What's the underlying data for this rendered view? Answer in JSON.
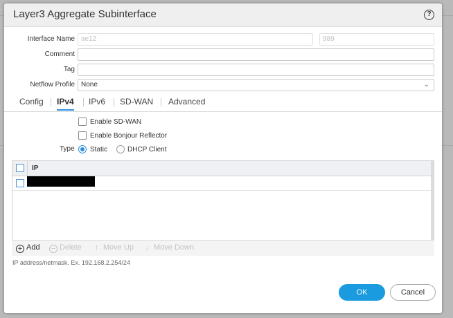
{
  "dialog": {
    "title": "Layer3 Aggregate Subinterface",
    "help_glyph": "?"
  },
  "form": {
    "interface_name": {
      "label": "Interface Name",
      "value": "ae12",
      "tag_value": "989"
    },
    "comment": {
      "label": "Comment",
      "value": ""
    },
    "tag": {
      "label": "Tag",
      "value": ""
    },
    "netflow_profile": {
      "label": "Netflow Profile",
      "value": "None"
    }
  },
  "tabs": [
    {
      "label": "Config",
      "active": false
    },
    {
      "label": "IPv4",
      "active": true
    },
    {
      "label": "IPv6",
      "active": false
    },
    {
      "label": "SD-WAN",
      "active": false
    },
    {
      "label": "Advanced",
      "active": false
    }
  ],
  "ipv4": {
    "enable_sdwan": {
      "label": "Enable SD-WAN",
      "checked": false
    },
    "enable_bonjour": {
      "label": "Enable Bonjour Reflector",
      "checked": false
    },
    "type": {
      "label": "Type",
      "options": [
        {
          "label": "Static",
          "selected": true
        },
        {
          "label": "DHCP Client",
          "selected": false
        }
      ]
    },
    "table": {
      "column_header": "IP",
      "rows": [
        {
          "value": ""
        }
      ]
    },
    "toolbar": {
      "add": "Add",
      "delete": "Delete",
      "move_up": "Move Up",
      "move_down": "Move Down"
    },
    "hint": "IP address/netmask. Ex. 192.168.2.254/24"
  },
  "footer": {
    "ok": "OK",
    "cancel": "Cancel"
  },
  "colors": {
    "accent": "#1a9be0",
    "active_tab_underline": "#2d8ee0"
  }
}
